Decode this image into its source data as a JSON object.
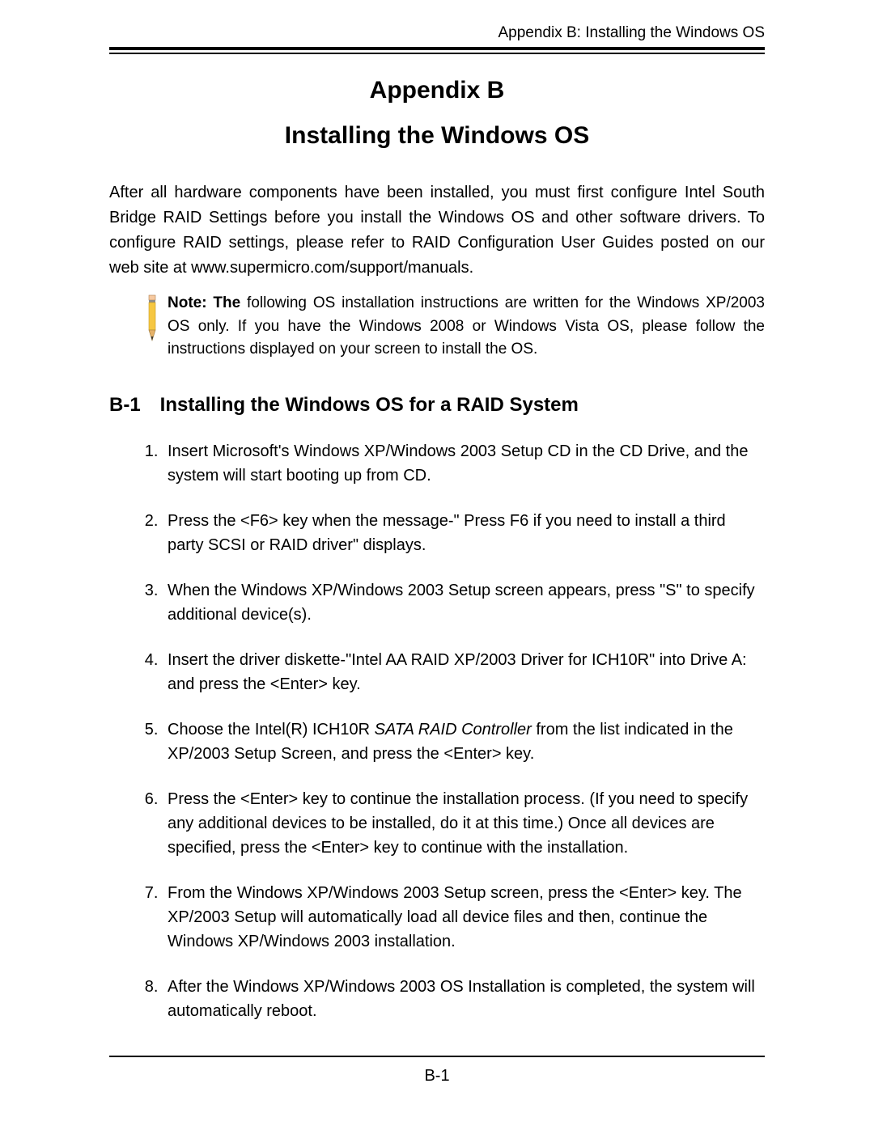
{
  "header": {
    "running_head": "Appendix B: Installing the Windows OS"
  },
  "titles": {
    "line1": "Appendix B",
    "line2": "Installing the Windows OS"
  },
  "intro": "After all hardware components have been installed, you must first configure Intel South Bridge RAID Settings before you install the Windows OS and other software drivers. To configure RAID settings, please refer to RAID Configuration User Guides posted on our web site at www.supermicro.com/support/manuals.",
  "note": {
    "label": "Note: The",
    "rest": " following OS installation instructions are written for the Windows XP/2003 OS only. If you have the Windows 2008 or Windows Vista OS, please follow the instructions displayed on your screen to install the OS."
  },
  "section": {
    "num": "B-1",
    "title": "Installing the Windows OS for a RAID System"
  },
  "steps": [
    {
      "pre": "Insert Microsoft's Windows XP/Windows 2003 Setup CD in the CD Drive, and the system will start booting up from CD.",
      "italic": "",
      "post": ""
    },
    {
      "pre": "Press the <F6> key when the message-\" Press F6 if you need to install a third party SCSI or RAID driver\" displays.",
      "italic": "",
      "post": ""
    },
    {
      "pre": "When the Windows XP/Windows 2003 Setup screen appears, press \"S\" to specify additional device(s).",
      "italic": "",
      "post": ""
    },
    {
      "pre": "Insert the driver diskette-\"Intel AA RAID XP/2003 Driver for ICH10R\" into Drive A: and press the <Enter> key.",
      "italic": "",
      "post": ""
    },
    {
      "pre": "Choose the Intel(R) ICH10R ",
      "italic": "SATA RAID Controller",
      "post": " from the list indicated in the XP/2003 Setup Screen, and press the <Enter> key."
    },
    {
      "pre": "Press the <Enter> key to continue the installation process. (If you need to specify any additional devices to be installed, do it at this time.) Once all devices are specified, press the <Enter> key to continue with the installation.",
      "italic": "",
      "post": ""
    },
    {
      "pre": "From the Windows XP/Windows 2003 Setup screen, press the <Enter> key. The XP/2003 Setup will automatically load all device files and then, continue the Windows XP/Windows 2003 installation.",
      "italic": "",
      "post": ""
    },
    {
      "pre": "After the Windows XP/Windows 2003 OS Installation is completed, the system will automatically reboot.",
      "italic": "",
      "post": ""
    }
  ],
  "footer": {
    "page_number": "B-1"
  }
}
